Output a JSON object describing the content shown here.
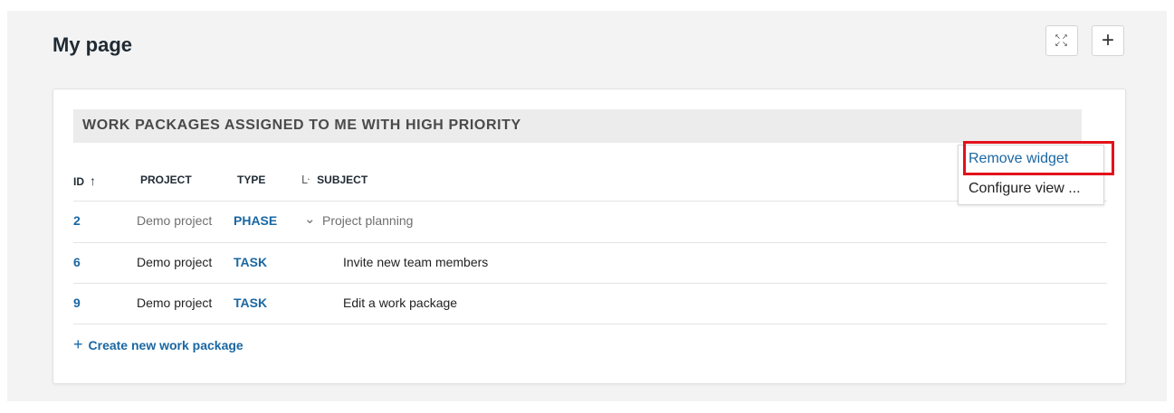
{
  "page": {
    "title": "My page"
  },
  "toolbar": {
    "expand_icon": "expand-icon",
    "add_label": "+"
  },
  "widget": {
    "title": "WORK PACKAGES ASSIGNED TO ME WITH HIGH PRIORITY",
    "columns": {
      "id": "ID",
      "project": "PROJECT",
      "type": "TYPE",
      "subject": "SUBJECT"
    },
    "sort_indicator": "↑",
    "rows": [
      {
        "id": "2",
        "project": "Demo project",
        "type": "PHASE",
        "subject": "Project planning",
        "expand": "⌄"
      },
      {
        "id": "6",
        "project": "Demo project",
        "type": "TASK",
        "subject": "Invite new team members"
      },
      {
        "id": "9",
        "project": "Demo project",
        "type": "TASK",
        "subject": "Edit a work package"
      }
    ],
    "create_label": "Create new work package",
    "create_plus": "+"
  },
  "menu": {
    "remove_label": "Remove widget",
    "configure_label": "Configure view ..."
  },
  "colors": {
    "link": "#1a67a3",
    "highlight": "#e3121a",
    "header_bg": "#ececec",
    "page_bg": "#f3f3f3"
  }
}
